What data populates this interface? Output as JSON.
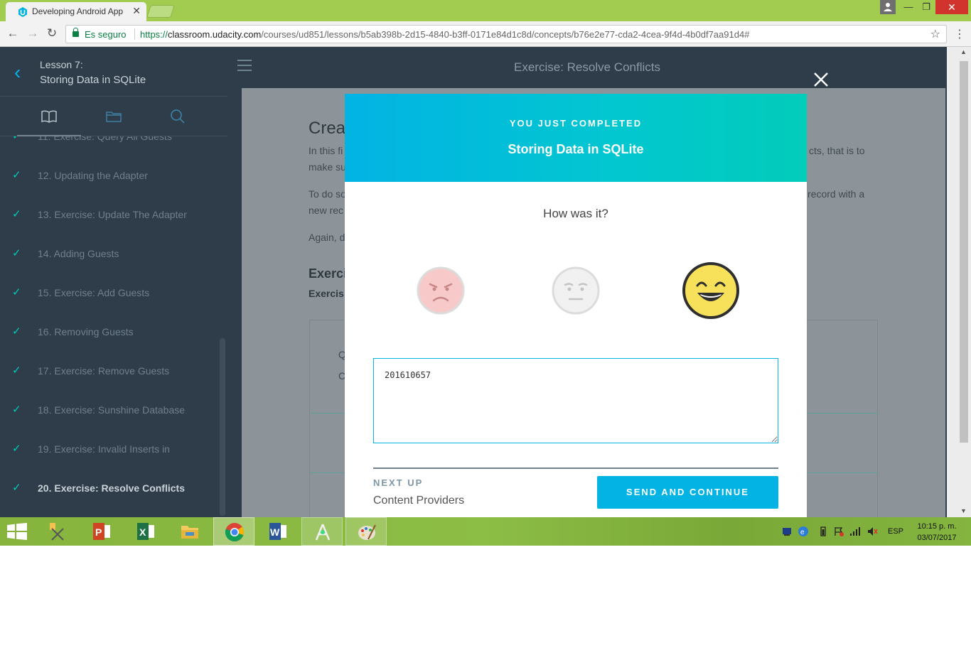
{
  "browser": {
    "tab_title": "Developing Android App",
    "secure_label": "Es seguro",
    "url_scheme": "https://",
    "url_host": "classroom.udacity.com",
    "url_path": "/courses/ud851/lessons/b5ab398b-2d15-4840-b3ff-0171e84d1c8d/concepts/b76e2e77-cda2-4cea-9f4d-4b0df7aa91d4#"
  },
  "sidebar": {
    "lesson_number": "Lesson 7:",
    "lesson_name": "Storing Data in SQLite",
    "concepts": [
      {
        "label": "11. Exercise: Query All Guests",
        "done": true
      },
      {
        "label": "12. Updating the Adapter",
        "done": true
      },
      {
        "label": "13. Exercise: Update The Adapter",
        "done": true
      },
      {
        "label": "14. Adding Guests",
        "done": true
      },
      {
        "label": "15. Exercise: Add Guests",
        "done": true
      },
      {
        "label": "16. Removing Guests",
        "done": true
      },
      {
        "label": "17. Exercise: Remove Guests",
        "done": true
      },
      {
        "label": "18. Exercise: Sunshine Database",
        "done": true
      },
      {
        "label": "19. Exercise: Invalid Inserts in",
        "done": true
      },
      {
        "label": "20. Exercise: Resolve Conflicts",
        "done": true,
        "active": true
      }
    ]
  },
  "topbar": {
    "title": "Exercise: Resolve Conflicts"
  },
  "background_content": {
    "heading": "Crea",
    "para1_line1": "In this fi",
    "para1_line2": "make su",
    "para1_right1": "cts, that is to",
    "para2_line1": "To do so",
    "para2_line2": "new rec",
    "para2_right1": "record with a",
    "para3": "Again, d",
    "section_heading": "Exerci",
    "section_sub": "Exercis",
    "box_q": "Q",
    "box_c": "C"
  },
  "modal": {
    "kicker": "YOU JUST COMPLETED",
    "title": "Storing Data in SQLite",
    "question": "How was it?",
    "ratings": [
      "sad",
      "neutral",
      "happy"
    ],
    "selected_rating": "happy",
    "feedback_value": "201610657",
    "next_label": "NEXT UP",
    "next_title": "Content Providers",
    "send_button": "SEND AND CONTINUE"
  },
  "taskbar": {
    "apps": [
      "snipping-tool",
      "powerpoint",
      "excel",
      "file-explorer",
      "chrome",
      "word",
      "android-studio",
      "paint"
    ],
    "active_app": "chrome",
    "language": "ESP",
    "time": "10:15 p. m.",
    "date": "03/07/2017"
  },
  "colors": {
    "udacity_blue": "#02b3e4",
    "udacity_teal": "#02ccba",
    "sidebar_bg": "#2e3d49",
    "taskbar_green": "#8cbd45"
  }
}
